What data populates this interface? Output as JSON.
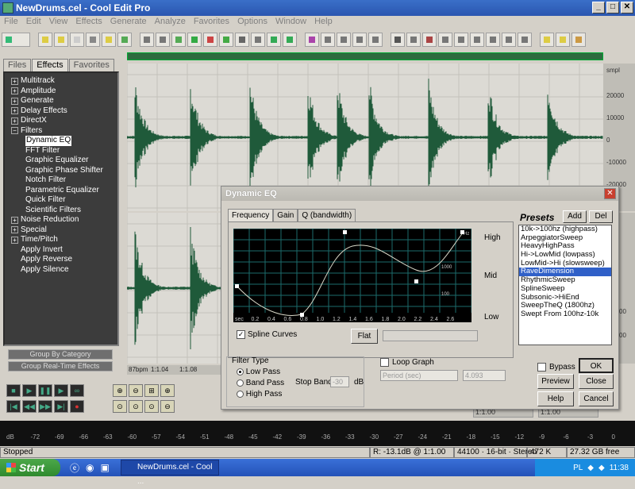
{
  "window": {
    "title": "NewDrums.cel - Cool Edit Pro",
    "min": "_",
    "max": "□",
    "close": "✕"
  },
  "menu": [
    "File",
    "Edit",
    "View",
    "Effects",
    "Generate",
    "Analyze",
    "Favorites",
    "Options",
    "Window",
    "Help"
  ],
  "left_panel": {
    "tabs": [
      "Files",
      "Effects",
      "Favorites"
    ],
    "tree": [
      {
        "label": "Multitrack",
        "expand": "+"
      },
      {
        "label": "Amplitude",
        "expand": "+"
      },
      {
        "label": "Generate",
        "expand": "+"
      },
      {
        "label": "Delay Effects",
        "expand": "+"
      },
      {
        "label": "DirectX",
        "expand": "+"
      },
      {
        "label": "Filters",
        "expand": "−"
      },
      {
        "label": "Dynamic EQ",
        "child": true,
        "selected": true
      },
      {
        "label": "FFT Filter",
        "child": true
      },
      {
        "label": "Graphic Equalizer",
        "child": true
      },
      {
        "label": "Graphic Phase Shifter",
        "child": true
      },
      {
        "label": "Notch Filter",
        "child": true
      },
      {
        "label": "Parametric Equalizer",
        "child": true
      },
      {
        "label": "Quick Filter",
        "child": true
      },
      {
        "label": "Scientific Filters",
        "child": true
      },
      {
        "label": "Noise Reduction",
        "expand": "+"
      },
      {
        "label": "Special",
        "expand": "+"
      },
      {
        "label": "Time/Pitch",
        "expand": "+"
      },
      {
        "label": "Apply Invert"
      },
      {
        "label": "Apply Reverse"
      },
      {
        "label": "Apply Silence"
      }
    ],
    "group_by_category": "Group By Category",
    "group_realtime": "Group Real-Time Effects"
  },
  "wave": {
    "ruler_unit": "smpl",
    "ruler_top": [
      "20000",
      "10000",
      "0",
      "-10000",
      "-20000"
    ],
    "ruler_bottom": [
      "-10000",
      "-20000"
    ],
    "time_labels": [
      "87bpm",
      "1:1.04",
      "1:1.08"
    ],
    "time_fields": [
      "1:1.00",
      "1:1.00"
    ]
  },
  "dialog": {
    "title": "Dynamic EQ",
    "close": "✕",
    "tabs": [
      "Frequency",
      "Gain",
      "Q (bandwidth)"
    ],
    "graph_axis": [
      "sec",
      "0.2",
      "0.4",
      "0.6",
      "0.8",
      "1.0",
      "1.2",
      "1.4",
      "1.6",
      "1.8",
      "2.0",
      "2.2",
      "2.4",
      "2.6"
    ],
    "graph_hz": [
      "Hz",
      "1000",
      "100"
    ],
    "levels": [
      "High",
      "Mid",
      "Low"
    ],
    "spline_label": "Spline Curves",
    "flat_button": "Flat",
    "presets": {
      "label": "Presets",
      "add": "Add",
      "del": "Del",
      "items": [
        "10k->100hz (highpass)",
        "ArpeggiatorSweep",
        "HeavyHighPass",
        "Hi->LowMid (lowpass)",
        "LowMid->Hi (slowsweep)",
        "RaveDimension",
        "RhythmicSweep",
        "SplineSweep",
        "Subsonic->HiEnd",
        "SweepTheQ (1800hz)",
        "Swept From 100hz-10k"
      ],
      "selected_index": 5
    },
    "filter_type": {
      "label": "Filter Type",
      "options": [
        "Low Pass",
        "Band Pass",
        "High Pass"
      ],
      "selected": 0,
      "stop_band_label": "Stop Band",
      "stop_band_value": "-30",
      "stop_band_unit": "dB"
    },
    "loop_graph_label": "Loop Graph",
    "period_placeholder": "Period (sec)",
    "period_value": "4.093",
    "bypass_label": "Bypass",
    "ok": "OK",
    "preview": "Preview",
    "close_button": "Close",
    "help": "Help",
    "cancel": "Cancel"
  },
  "levels_scale": [
    "dB",
    "-72",
    "-69",
    "-66",
    "-63",
    "-60",
    "-57",
    "-54",
    "-51",
    "-48",
    "-45",
    "-42",
    "-39",
    "-36",
    "-33",
    "-30",
    "-27",
    "-24",
    "-21",
    "-18",
    "-15",
    "-12",
    "-9",
    "-6",
    "-3",
    "0"
  ],
  "status": {
    "state": "Stopped",
    "position": "R: -13.1dB @ 1:1.00",
    "format": "44100 · 16-bit · Stereo",
    "size": "472 K",
    "free": "27.32 GB free"
  },
  "taskbar": {
    "start": "Start",
    "task": "NewDrums.cel - Cool ...",
    "lang": "PL",
    "clock": "11:38"
  }
}
